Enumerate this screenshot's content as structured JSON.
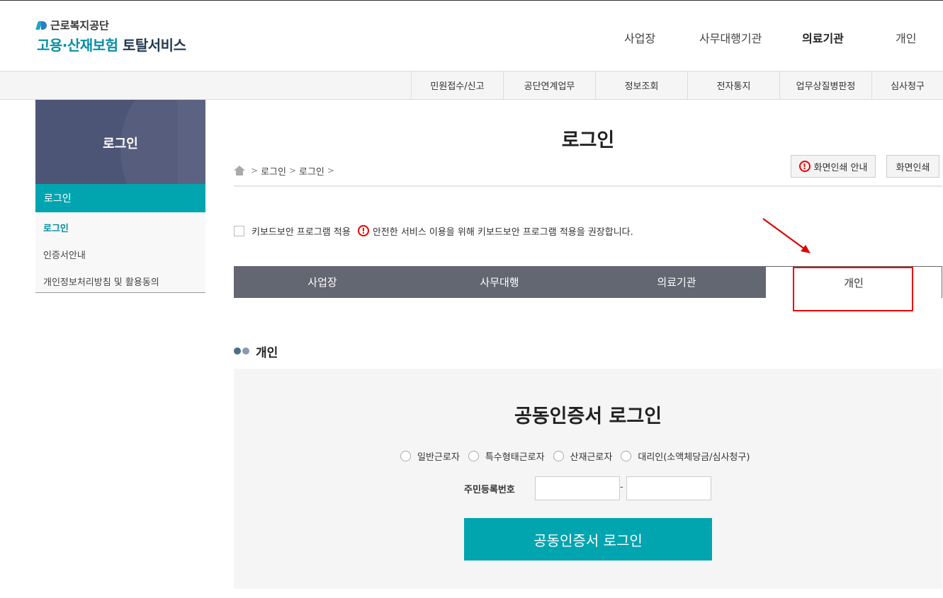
{
  "logo": {
    "org": "근로복지공단",
    "service_teal": "고용·산재보험",
    "service_dark": "토탈서비스"
  },
  "gnb": {
    "items": [
      "사업장",
      "사무대행기관",
      "의료기관",
      "개인"
    ],
    "active": "의료기관"
  },
  "subnav": {
    "items": [
      "민원접수/신고",
      "공단연계업무",
      "정보조회",
      "전자통지",
      "업무상질병판정",
      "심사청구"
    ]
  },
  "sidebar": {
    "banner_title": "로그인",
    "active_label": "로그인",
    "items": [
      {
        "label": "로그인",
        "current": true
      },
      {
        "label": "인증서안내",
        "current": false
      },
      {
        "label": "개인정보처리방침 및 활용동의",
        "current": false
      }
    ]
  },
  "content": {
    "title": "로그인",
    "breadcrumb": [
      "로그인",
      "로그인"
    ],
    "print_guide_label": "화면인쇄 안내",
    "print_label": "화면인쇄",
    "keyboard_security_label": "키보드보안 프로그램 적용",
    "keyboard_security_notice": "안전한 서비스 이용을 위해 키보드보안 프로그램 적용을 권장합니다.",
    "alert_glyph": "!"
  },
  "tabs": {
    "items": [
      "사업장",
      "사무대행",
      "의료기관",
      "개인"
    ],
    "selected": "개인"
  },
  "section": {
    "heading": "개인"
  },
  "login": {
    "title": "공동인증서 로그인",
    "radio_options": [
      "일반근로자",
      "특수형태근로자",
      "산재근로자",
      "대리인(소액체당금/심사청구)"
    ],
    "rrn_label": "주민등록번호",
    "rrn_dash": "-",
    "rrn_first": "",
    "rrn_second": "",
    "button_label": "공동인증서 로그인"
  },
  "colors": {
    "teal": "#00a5b0",
    "tab_bg": "#636772",
    "sidebar_banner": "#4d5577",
    "annotation_red": "#e00000",
    "dot_1": "#4a6f86",
    "dot_2": "#8a9bb0"
  }
}
